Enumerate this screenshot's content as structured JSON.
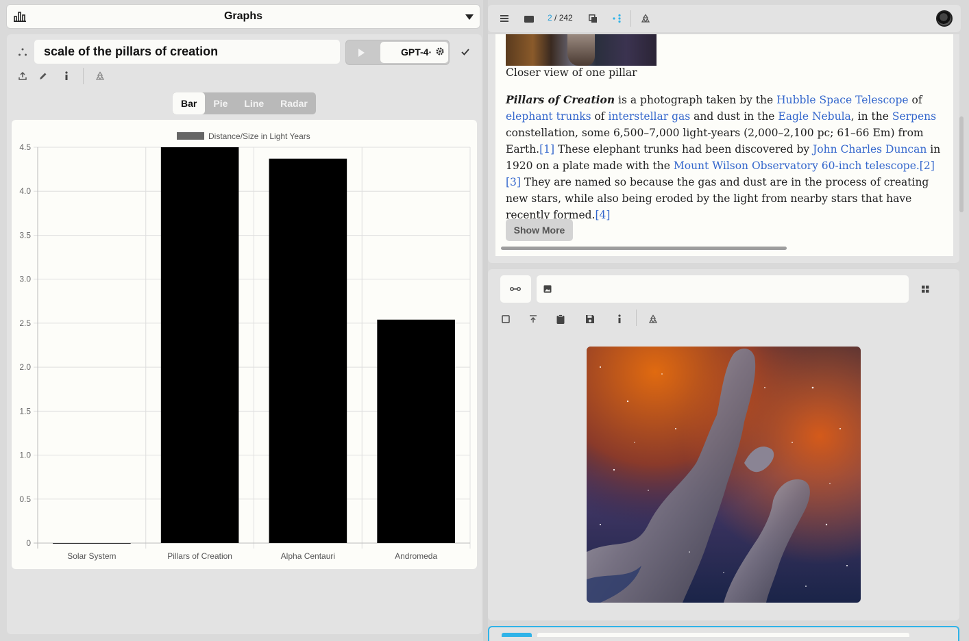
{
  "header": {
    "title": "Graphs"
  },
  "query": {
    "value": "scale of the pillars of creation"
  },
  "model": {
    "label": "GPT-4·"
  },
  "chart_tabs": [
    {
      "label": "Bar",
      "active": true
    },
    {
      "label": "Pie",
      "active": false
    },
    {
      "label": "Line",
      "active": false
    },
    {
      "label": "Radar",
      "active": false
    }
  ],
  "chart_data": {
    "type": "bar",
    "legend": "Distance/Size in Light Years",
    "categories": [
      "Solar System",
      "Pillars of Creation",
      "Alpha Centauri",
      "Andromeda"
    ],
    "values": [
      0.0,
      4.5,
      4.37,
      2.54
    ],
    "ylim": [
      0,
      4.5
    ],
    "yticks": [
      "0",
      "0.5",
      "1.0",
      "1.5",
      "2.0",
      "2.5",
      "3.0",
      "3.5",
      "4.0",
      "4.5"
    ],
    "bar_color": "#000000",
    "grid": true,
    "legend_position": "top-center"
  },
  "viewer": {
    "page_current": "2",
    "page_total": " / 242"
  },
  "wiki": {
    "caption": "Closer view of one pillar",
    "title": "Pillars of Creation",
    "t1": " is a photograph taken by the ",
    "l1": "Hubble Space Telescope",
    "t2": " of ",
    "l2": "elephant trunks",
    "t3": " of ",
    "l3": "interstellar gas",
    "t4": " and dust in the ",
    "l4": "Eagle Nebula",
    "t5": ", in the ",
    "l5": "Serpens",
    "t6": " constellation, some 6,500–7,000 light-years (2,000–2,100 pc; 61–66 Em) from Earth.",
    "r1": "[1]",
    "t7": " These elephant trunks had been discovered by ",
    "l6": "John Charles Duncan",
    "t8": " in 1920 on a plate made with the ",
    "l7": "Mount Wilson Observatory 60-inch telescope.",
    "r2": "[2]",
    "r3": "[3]",
    "t9": " They are named so because the gas and dust are in the process of creating new stars, while also being eroded by the light from nearby stars that have recently formed.",
    "r4": "[4]",
    "show_more": "Show More"
  },
  "colors": {
    "accent": "#2fb3e8",
    "link": "#3366cc"
  }
}
